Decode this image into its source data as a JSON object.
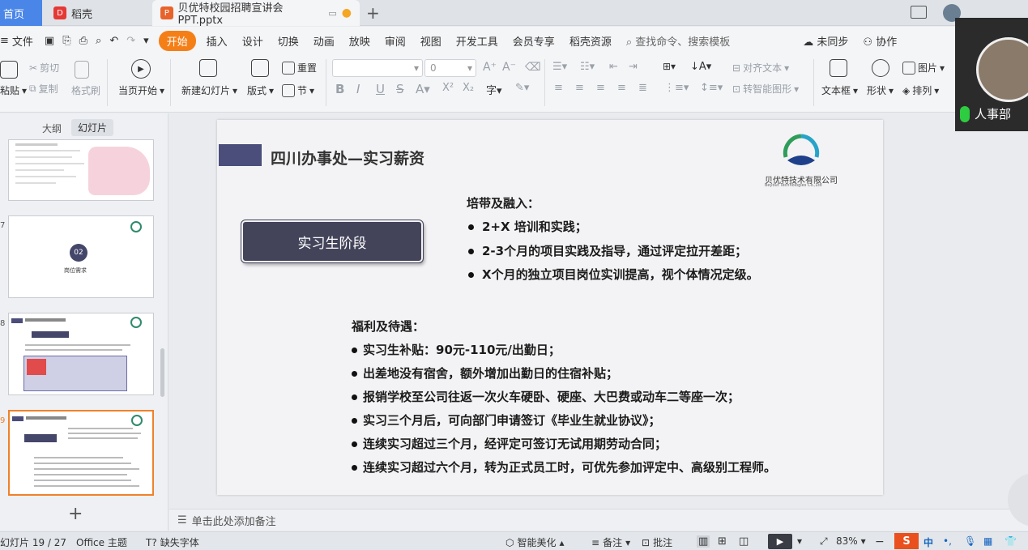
{
  "tabs": {
    "home": "首页",
    "docer": "稻壳",
    "doc_title": "贝优特校园招聘宣讲会PPT.pptx"
  },
  "menu": {
    "file": "文件",
    "items": [
      "开始",
      "插入",
      "设计",
      "切换",
      "动画",
      "放映",
      "审阅",
      "视图",
      "开发工具",
      "会员专享",
      "稻壳资源"
    ],
    "search_placeholder": "查找命令、搜索模板",
    "sync": "未同步",
    "collab": "协作"
  },
  "ribbon": {
    "paste": "粘贴",
    "cut": "剪切",
    "copy": "复制",
    "format_painter": "格式刷",
    "play_from_current": "当页开始",
    "new_slide": "新建幻灯片",
    "layout": "版式",
    "section": "节",
    "reset": "重置",
    "font_size": "0",
    "align_text": "对齐文本",
    "smart_shape": "转智能图形",
    "textbox": "文本框",
    "shape": "形状",
    "picture": "图片",
    "arrange": "排列"
  },
  "left_pane": {
    "tab_outline": "大纲",
    "tab_slides": "幻灯片",
    "slide_numbers": [
      "7",
      "8",
      "9"
    ],
    "thumb_badge": "02",
    "thumb7_caption": "岗位需求",
    "add_slide": "+"
  },
  "slide": {
    "title": "四川办事处—实习薪资",
    "company": "贝优特技术有限公司",
    "company_en": "Beyout Technologies Co.,Ltd",
    "stage_box": "实习生阶段",
    "section1_heading": "培带及融入：",
    "section1_items": [
      "2+X 培训和实践；",
      "2-3个月的项目实践及指导，通过评定拉开差距；",
      "X个月的独立项目岗位实训提高，视个体情况定级。"
    ],
    "section2_heading": "福利及待遇：",
    "section2_items": [
      "实习生补贴：90元-110元/出勤日；",
      "出差地没有宿舍，额外增加出勤日的住宿补贴；",
      "报销学校至公司往返一次火车硬卧、硬座、大巴费或动车二等座一次；",
      "实习三个月后，可向部门申请签订《毕业生就业协议》；",
      "连续实习超过三个月，经评定可签订无试用期劳动合同；",
      "连续实习超过六个月，转为正式员工时，可优先参加评定中、高级别工程师。"
    ]
  },
  "notes": {
    "placeholder": "单击此处添加备注"
  },
  "status": {
    "slide_info": "幻灯片 19 / 27",
    "theme": "Office 主题",
    "missing_font": "缺失字体",
    "beautify": "智能美化",
    "notes": "备注",
    "comments": "批注",
    "zoom": "83%",
    "ime": "中"
  },
  "video": {
    "name": "人事部"
  },
  "colors": {
    "accent_orange": "#f57f17",
    "title_bar": "#4b4d7a",
    "stage_box": "#43445a",
    "selection": "#f0812a"
  }
}
